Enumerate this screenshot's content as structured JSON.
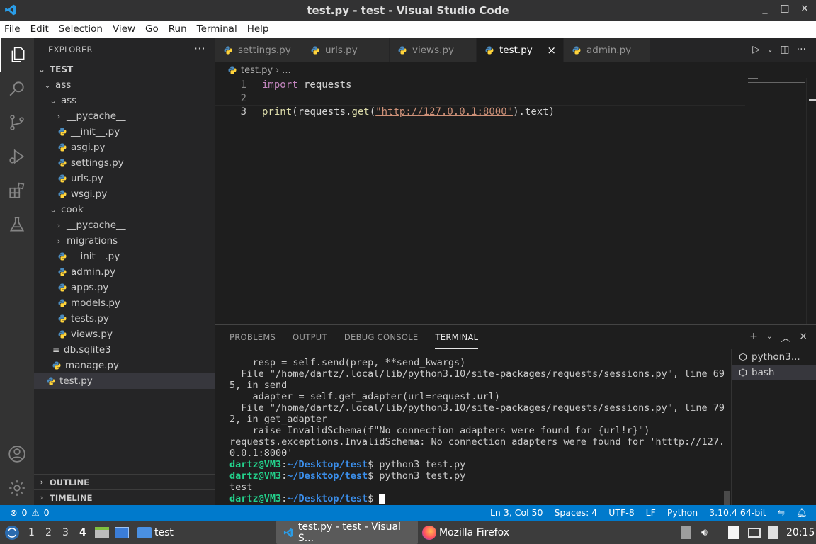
{
  "window": {
    "title": "test.py - test - Visual Studio Code",
    "buttons": [
      "_",
      "□",
      "×"
    ]
  },
  "menu": [
    "File",
    "Edit",
    "Selection",
    "View",
    "Go",
    "Run",
    "Terminal",
    "Help"
  ],
  "activity": [
    "explorer-icon",
    "search-icon",
    "source-control-icon",
    "run-debug-icon",
    "extensions-icon",
    "testing-icon",
    "account-icon",
    "settings-gear-icon"
  ],
  "sidebar": {
    "header": "EXPLORER",
    "more": "···",
    "tree": [
      {
        "label": "TEST",
        "type": "folder-open",
        "depth": 0,
        "bold": true
      },
      {
        "label": "ass",
        "type": "folder-open",
        "depth": 1
      },
      {
        "label": "ass",
        "type": "folder-open",
        "depth": 2
      },
      {
        "label": "__pycache__",
        "type": "folder-closed",
        "depth": 3
      },
      {
        "label": "__init__.py",
        "type": "py",
        "depth": 3
      },
      {
        "label": "asgi.py",
        "type": "py",
        "depth": 3
      },
      {
        "label": "settings.py",
        "type": "py",
        "depth": 3
      },
      {
        "label": "urls.py",
        "type": "py",
        "depth": 3
      },
      {
        "label": "wsgi.py",
        "type": "py",
        "depth": 3
      },
      {
        "label": "cook",
        "type": "folder-open",
        "depth": 2
      },
      {
        "label": "__pycache__",
        "type": "folder-closed",
        "depth": 3
      },
      {
        "label": "migrations",
        "type": "folder-closed",
        "depth": 3
      },
      {
        "label": "__init__.py",
        "type": "py",
        "depth": 3
      },
      {
        "label": "admin.py",
        "type": "py",
        "depth": 3
      },
      {
        "label": "apps.py",
        "type": "py",
        "depth": 3
      },
      {
        "label": "models.py",
        "type": "py",
        "depth": 3
      },
      {
        "label": "tests.py",
        "type": "py",
        "depth": 3
      },
      {
        "label": "views.py",
        "type": "py",
        "depth": 3
      },
      {
        "label": "db.sqlite3",
        "type": "db",
        "depth": 2
      },
      {
        "label": "manage.py",
        "type": "py",
        "depth": 2
      },
      {
        "label": "test.py",
        "type": "py",
        "depth": 1,
        "selected": true
      }
    ],
    "outline": "OUTLINE",
    "timeline": "TIMELINE"
  },
  "tabs": [
    {
      "label": "settings.py",
      "active": false
    },
    {
      "label": "urls.py",
      "active": false
    },
    {
      "label": "views.py",
      "active": false
    },
    {
      "label": "test.py",
      "active": true
    },
    {
      "label": "admin.py",
      "active": false
    }
  ],
  "tab_close": "×",
  "breadcrumb": {
    "file": "test.py",
    "sep": "›",
    "rest": "..."
  },
  "editor": {
    "lines": [
      {
        "n": "1",
        "tokens": [
          [
            "kw",
            "import"
          ],
          [
            "plain",
            " requests"
          ]
        ]
      },
      {
        "n": "2",
        "tokens": []
      },
      {
        "n": "3",
        "tokens": [
          [
            "fn",
            "print"
          ],
          [
            "plain",
            "(requests."
          ],
          [
            "fn",
            "get"
          ],
          [
            "plain",
            "("
          ],
          [
            "str",
            "\"http://127.0.0.1:8000\""
          ],
          [
            "plain",
            ").text)"
          ]
        ],
        "current": true
      }
    ]
  },
  "panel": {
    "tabs": [
      "PROBLEMS",
      "OUTPUT",
      "DEBUG CONSOLE",
      "TERMINAL"
    ],
    "active_tab": "TERMINAL",
    "terminal_lines": [
      "    resp = self.send(prep, **send_kwargs)",
      "  File \"/home/dartz/.local/lib/python3.10/site-packages/requests/sessions.py\", line 69",
      "5, in send",
      "    adapter = self.get_adapter(url=request.url)",
      "  File \"/home/dartz/.local/lib/python3.10/site-packages/requests/sessions.py\", line 79",
      "2, in get_adapter",
      "    raise InvalidSchema(f\"No connection adapters were found for {url!r}\")",
      "requests.exceptions.InvalidSchema: No connection adapters were found for 'htttp://127.",
      "0.0.1:8000'"
    ],
    "prompts": [
      {
        "user": "dartz@VM3",
        "path": "~/Desktop/test",
        "cmd": "$ python3 test.py"
      },
      {
        "user": "dartz@VM3",
        "path": "~/Desktop/test",
        "cmd": "$ python3 test.py"
      }
    ],
    "output_after": "test",
    "final_prompt": {
      "user": "dartz@VM3",
      "path": "~/Desktop/test",
      "cmd": "$ "
    },
    "terminals": [
      {
        "label": "python3...",
        "active": false
      },
      {
        "label": "bash",
        "active": true
      }
    ]
  },
  "status": {
    "errors": "0",
    "warnings": "0",
    "position": "Ln 3, Col 50",
    "spaces": "Spaces: 4",
    "encoding": "UTF-8",
    "eol": "LF",
    "language": "Python",
    "interpreter": "3.10.4 64-bit"
  },
  "taskbar": {
    "workspaces": [
      "1",
      "2",
      "3",
      "4"
    ],
    "active_workspace": "4",
    "folder": "test",
    "windows": [
      "test.py - test - Visual S...",
      "Mozilla Firefox"
    ],
    "clock": "20:15"
  }
}
